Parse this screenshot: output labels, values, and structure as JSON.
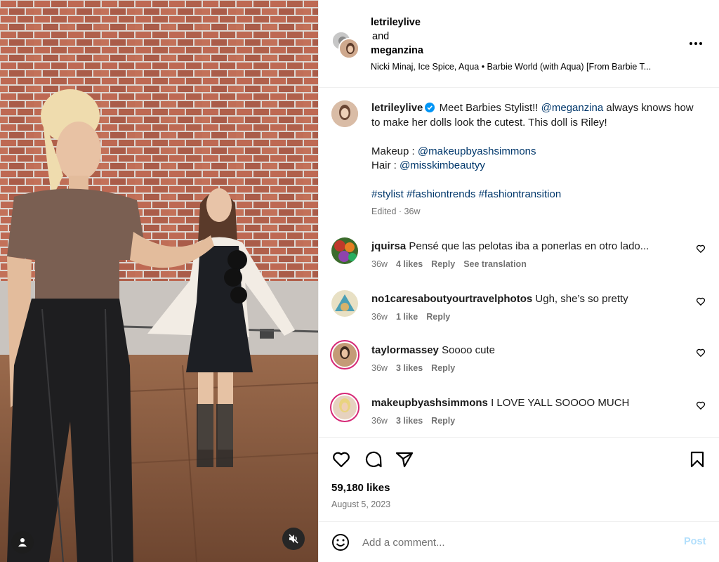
{
  "post": {
    "author1": "letrileylive",
    "and_text": "and",
    "author2": "meganzina",
    "audio": "Nicki Minaj, Ice Spice, Aqua • Barbie World (with Aqua) [From Barbie T...",
    "more_label": "•••"
  },
  "caption": {
    "username": "letrileylive",
    "text1": "Meet Barbies Stylist!!",
    "mention1": "@meganzina",
    "text2": "always knows how to make her dolls look the cutest. This doll is Riley!",
    "makeup_label": "Makeup :",
    "makeup_mention": "@makeupbyashsimmons",
    "hair_label": "Hair :",
    "hair_mention": "@misskimbeautyy",
    "tag1": "#stylist",
    "tag2": "#fashiontrends",
    "tag3": "#fashiontransition",
    "meta": "Edited · 36w"
  },
  "comments": [
    {
      "username": "jquirsa",
      "text": "Pensé que las pelotas iba a ponerlas en otro lado...",
      "time": "36w",
      "likes": "4 likes",
      "reply": "Reply",
      "extra": "See translation"
    },
    {
      "username": "no1caresaboutyourtravelphotos",
      "text": "Ugh, she’s so pretty",
      "time": "36w",
      "likes": "1 like",
      "reply": "Reply",
      "extra": ""
    },
    {
      "username": "taylormassey",
      "text": "Soooo cute",
      "time": "36w",
      "likes": "3 likes",
      "reply": "Reply",
      "extra": ""
    },
    {
      "username": "makeupbyashsimmons",
      "text": "I LOVE YALL SOOOO MUCH",
      "time": "36w",
      "likes": "3 likes",
      "reply": "Reply",
      "extra": ""
    }
  ],
  "stats": {
    "likes": "59,180 likes",
    "date": "August 5, 2023"
  },
  "composer": {
    "placeholder": "Add a comment...",
    "post_label": "Post"
  },
  "colors": {
    "link": "#00376b",
    "muted": "#737373",
    "post_disabled": "#b2dffc",
    "verified": "#0095f6"
  }
}
